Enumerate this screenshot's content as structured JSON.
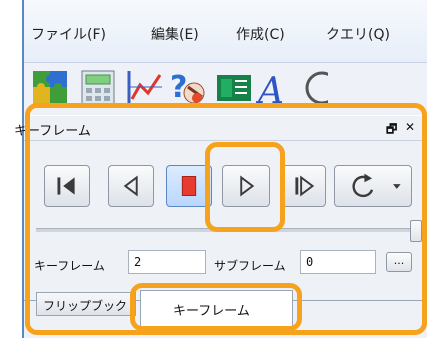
{
  "menu": {
    "items": [
      "ファイル(F)",
      "編集(E)",
      "作成(C)",
      "クエリ(Q)"
    ]
  },
  "toolbar": {
    "icons": [
      "puzzle-icon",
      "calculator-icon",
      "line-graph-icon",
      "query-help-icon",
      "table-icon",
      "text-style-icon",
      "refresh-icon"
    ]
  },
  "keyframe_panel": {
    "title": "キーフレーム",
    "pin_glyph": "🗗",
    "close_glyph": "✕",
    "keyframe_label": "キーフレーム",
    "keyframe_value": "2",
    "subframe_label": "サブフレーム",
    "subframe_value": "0",
    "browse_label": "...",
    "playback_buttons": [
      "skip-to-start",
      "step-back",
      "stop",
      "play",
      "step-forward",
      "loop-mode"
    ],
    "slider_level": 1.0
  },
  "tabs": [
    {
      "label": "フリップブック",
      "active": false
    },
    {
      "label": "キーフレーム",
      "active": true
    }
  ],
  "colors": {
    "highlight": "#f6a21d",
    "accent": "#5b87c4",
    "stop_red": "#e63b2e"
  }
}
